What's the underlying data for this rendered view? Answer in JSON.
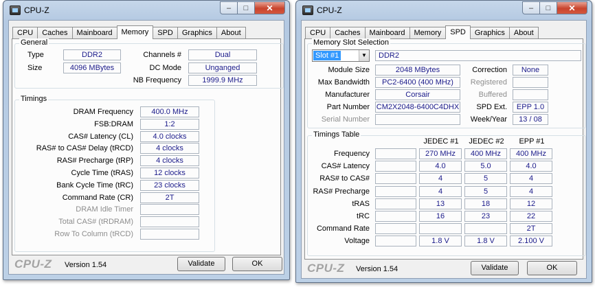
{
  "window1": {
    "title": "CPU-Z",
    "tabs": [
      "CPU",
      "Caches",
      "Mainboard",
      "Memory",
      "SPD",
      "Graphics",
      "About"
    ],
    "active_tab": "Memory",
    "general": {
      "title": "General",
      "type_label": "Type",
      "type_value": "DDR2",
      "size_label": "Size",
      "size_value": "4096 MBytes",
      "channels_label": "Channels #",
      "channels_value": "Dual",
      "dcmode_label": "DC Mode",
      "dcmode_value": "Unganged",
      "nbfreq_label": "NB Frequency",
      "nbfreq_value": "1999.9 MHz"
    },
    "timings": {
      "title": "Timings",
      "rows": [
        {
          "label": "DRAM Frequency",
          "value": "400.0 MHz",
          "enabled": true
        },
        {
          "label": "FSB:DRAM",
          "value": "1:2",
          "enabled": true
        },
        {
          "label": "CAS# Latency (CL)",
          "value": "4.0 clocks",
          "enabled": true
        },
        {
          "label": "RAS# to CAS# Delay (tRCD)",
          "value": "4 clocks",
          "enabled": true
        },
        {
          "label": "RAS# Precharge (tRP)",
          "value": "4 clocks",
          "enabled": true
        },
        {
          "label": "Cycle Time (tRAS)",
          "value": "12 clocks",
          "enabled": true
        },
        {
          "label": "Bank Cycle Time (tRC)",
          "value": "23 clocks",
          "enabled": true
        },
        {
          "label": "Command Rate (CR)",
          "value": "2T",
          "enabled": true
        },
        {
          "label": "DRAM Idle Timer",
          "value": "",
          "enabled": false
        },
        {
          "label": "Total CAS# (tRDRAM)",
          "value": "",
          "enabled": false
        },
        {
          "label": "Row To Column (tRCD)",
          "value": "",
          "enabled": false
        }
      ]
    },
    "footer": {
      "brand": "CPU-Z",
      "version": "Version 1.54",
      "validate": "Validate",
      "ok": "OK"
    }
  },
  "window2": {
    "title": "CPU-Z",
    "tabs": [
      "CPU",
      "Caches",
      "Mainboard",
      "Memory",
      "SPD",
      "Graphics",
      "About"
    ],
    "active_tab": "SPD",
    "slot": {
      "title": "Memory Slot Selection",
      "selected": "Slot #1",
      "type_value": "DDR2",
      "module_size_label": "Module Size",
      "module_size_value": "2048 MBytes",
      "max_bw_label": "Max Bandwidth",
      "max_bw_value": "PC2-6400 (400 MHz)",
      "manufacturer_label": "Manufacturer",
      "manufacturer_value": "Corsair",
      "part_label": "Part Number",
      "part_value": "CM2X2048-6400C4DHX",
      "serial_label": "Serial Number",
      "serial_value": "",
      "correction_label": "Correction",
      "correction_value": "None",
      "registered_label": "Registered",
      "registered_value": "",
      "buffered_label": "Buffered",
      "buffered_value": "",
      "spdext_label": "SPD Ext.",
      "spdext_value": "EPP 1.0",
      "weekyear_label": "Week/Year",
      "weekyear_value": "13 / 08"
    },
    "timings_table": {
      "title": "Timings Table",
      "columns": [
        "JEDEC #1",
        "JEDEC #2",
        "EPP #1"
      ],
      "rows": [
        {
          "label": "Frequency",
          "values": [
            "270 MHz",
            "400 MHz",
            "400 MHz"
          ]
        },
        {
          "label": "CAS# Latency",
          "values": [
            "4.0",
            "5.0",
            "4.0"
          ]
        },
        {
          "label": "RAS# to CAS#",
          "values": [
            "4",
            "5",
            "4"
          ]
        },
        {
          "label": "RAS# Precharge",
          "values": [
            "4",
            "5",
            "4"
          ]
        },
        {
          "label": "tRAS",
          "values": [
            "13",
            "18",
            "12"
          ]
        },
        {
          "label": "tRC",
          "values": [
            "16",
            "23",
            "22"
          ]
        },
        {
          "label": "Command Rate",
          "values": [
            "",
            "",
            "2T"
          ]
        },
        {
          "label": "Voltage",
          "values": [
            "1.8 V",
            "1.8 V",
            "2.100 V"
          ]
        }
      ]
    },
    "footer": {
      "brand": "CPU-Z",
      "version": "Version 1.54",
      "validate": "Validate",
      "ok": "OK"
    }
  },
  "window_buttons": {
    "minimize": "–",
    "maximize": "□",
    "close": "✕"
  },
  "icons": {
    "app": "cpu-z-app-icon",
    "dropdown": "▼"
  }
}
